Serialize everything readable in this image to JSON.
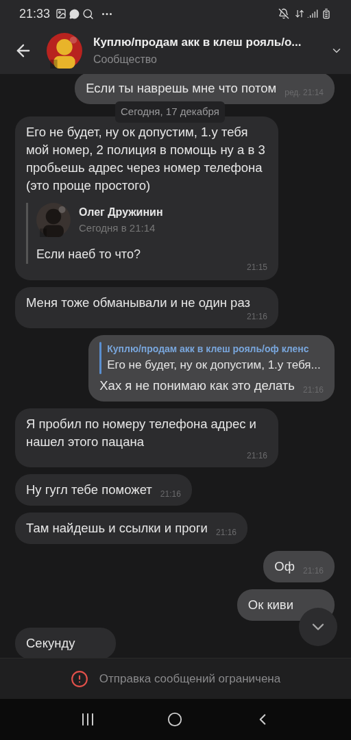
{
  "status_bar": {
    "time": "21:33"
  },
  "header": {
    "title": "Куплю/продам акк в клеш рояль/о...",
    "subtitle": "Сообщество"
  },
  "date_pill": "Сегодня, 17 декабря",
  "messages": [
    {
      "kind": "outgoing",
      "text": "Если ты наврешь мне что потом",
      "time": "ред. 21:14"
    },
    {
      "kind": "incoming",
      "text": "Его не будет, ну ок допустим, 1.у тебя мой номер, 2 полиция в помощь ну а в 3 пробьешь адрес через номер телефона (это проще простого)",
      "forward": {
        "author": "Олег Дружинин",
        "time": "Сегодня в 21:14",
        "text": "Если наеб то что?"
      },
      "time": "21:15"
    },
    {
      "kind": "incoming",
      "text": "Меня тоже обманывали и не один раз",
      "time": "21:16"
    },
    {
      "kind": "outgoing",
      "reply": {
        "title": "Куплю/продам акк в клеш рояль/оф кленс",
        "text": "Его не будет, ну ок допустим, 1.у тебя..."
      },
      "text": "Хах я не понимаю как это делать",
      "time": "21:16"
    },
    {
      "kind": "incoming",
      "text": "Я пробил по номеру телефона адрес и нашел этого пацана",
      "time": "21:16"
    },
    {
      "kind": "incoming",
      "text": "Ну гугл тебе поможет",
      "time": "21:16"
    },
    {
      "kind": "incoming",
      "text": "Там найдешь и ссылки и проги",
      "time": "21:16"
    },
    {
      "kind": "outgoing",
      "text": "Оф",
      "time": "21:16"
    },
    {
      "kind": "outgoing",
      "text": "Ок киви"
    },
    {
      "kind": "incoming",
      "text": "Секунду"
    }
  ],
  "notice": "Отправка сообщений ограничена"
}
